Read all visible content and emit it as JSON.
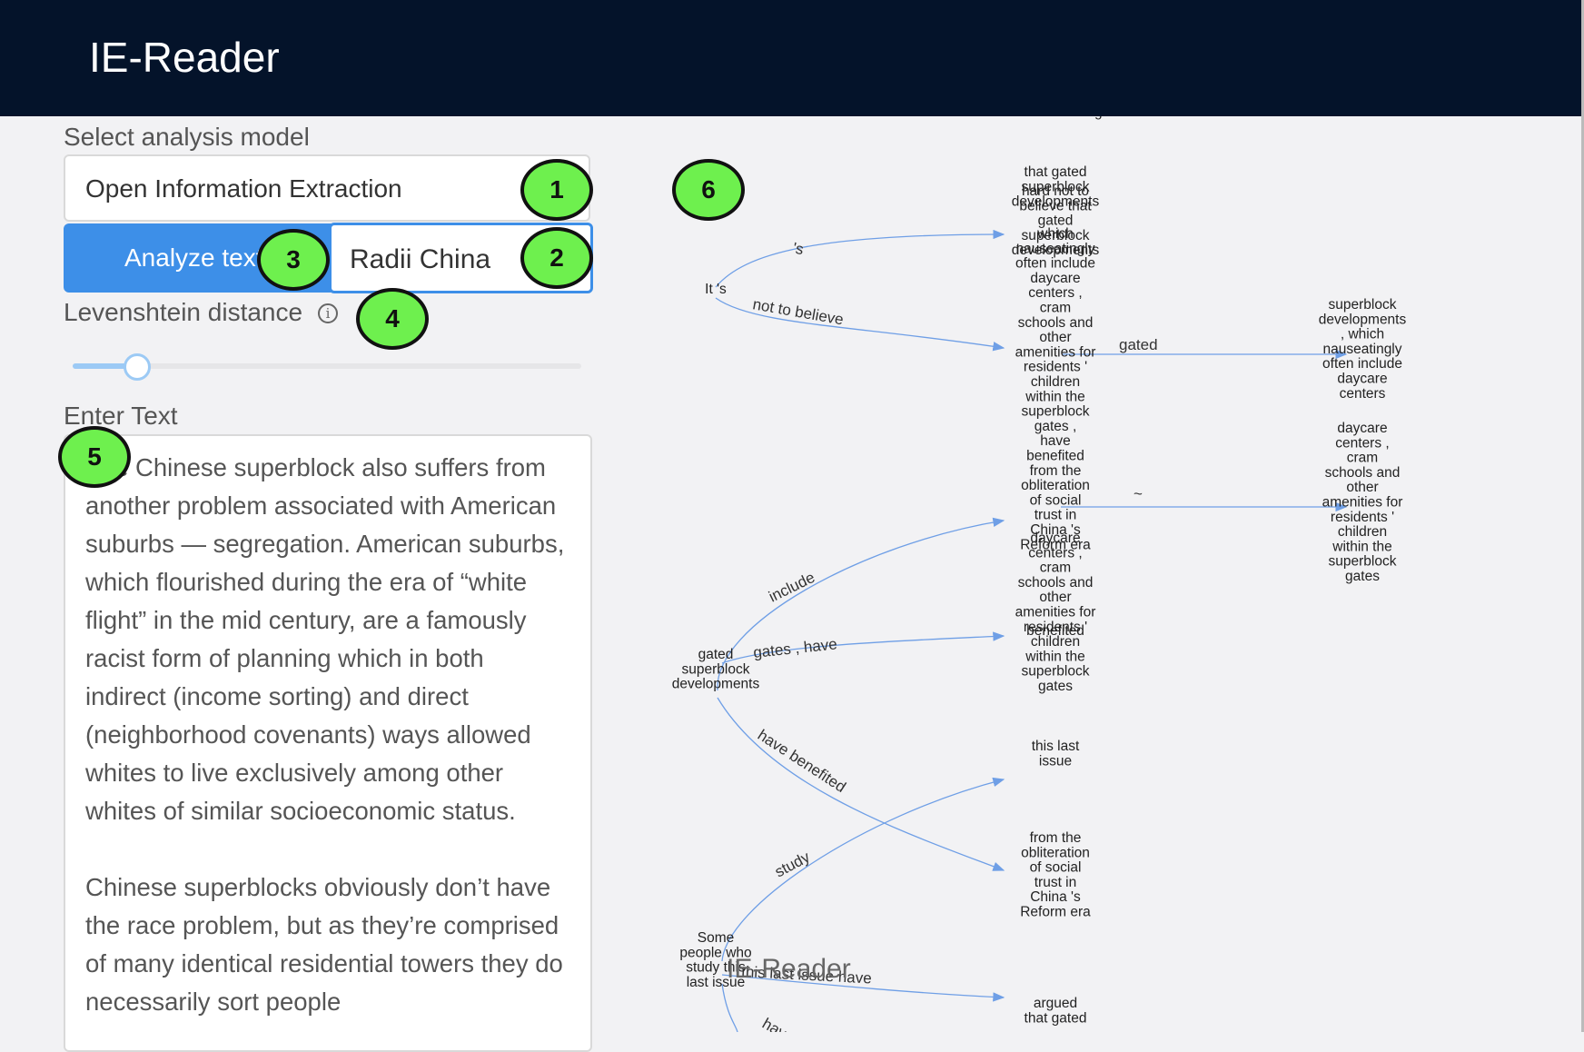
{
  "header": {
    "title": "IE-Reader"
  },
  "controls": {
    "model_label": "Select analysis model",
    "model_value": "Open Information Extraction",
    "analyze_label": "Analyze text",
    "entity_value": "Radii China",
    "levenshtein_label": "Levenshtein distance",
    "levenshtein_value": 0.1,
    "text_label": "Enter Text",
    "text_p1": "The Chinese superblock also suffers from another problem associated with American suburbs — segregation. American suburbs, which flourished during the era of “white flight” in the mid century, are a famously racist form of planning which in both indirect (income sorting) and direct (neighborhood covenants) ways allowed whites to live exclusively among other whites of similar socioeconomic status.",
    "text_p2": "Chinese superblocks obviously don’t have the race problem, but as they’re comprised of many identical residential towers they do necessarily sort people"
  },
  "badges": [
    "1",
    "2",
    "3",
    "4",
    "5",
    "6"
  ],
  "graph": {
    "nodes": [
      {
        "id": "top",
        "text": [
          "r o m e t h i n g"
        ]
      },
      {
        "id": "its",
        "text": [
          "It 's"
        ]
      },
      {
        "id": "a1",
        "text": [
          "that gated",
          "superblock",
          "developments"
        ]
      },
      {
        "id": "a2",
        "text": [
          "hard not to",
          "believe that",
          "gated",
          "superblock",
          "developments"
        ]
      },
      {
        "id": "a3",
        "text": [
          "which",
          "nauseatingly",
          "often include",
          "daycare",
          "centers ,",
          "cram",
          "schools and",
          "other",
          "amenities for",
          "residents '",
          "children",
          "within the",
          "superblock",
          "gates ,",
          "have",
          "benefited",
          "from the",
          "obliteration",
          "of social",
          "trust in",
          "China 's",
          "Reform era"
        ]
      },
      {
        "id": "sd",
        "text": [
          "superblock",
          "developments",
          ", which",
          "nauseatingly",
          "often include",
          "daycare",
          "centers"
        ]
      },
      {
        "id": "dc",
        "text": [
          "daycare",
          "centers ,",
          "cram",
          "schools and",
          "other",
          "amenities for",
          "residents '",
          "children",
          "within the",
          "superblock",
          "gates"
        ]
      },
      {
        "id": "dc2",
        "text": [
          "daycare",
          "centers ,",
          "cram",
          "schools and",
          "other",
          "amenities for",
          "residents '",
          "children",
          "within the",
          "superblock",
          "gates"
        ]
      },
      {
        "id": "gsd",
        "text": [
          "gated",
          "superblock",
          "developments"
        ]
      },
      {
        "id": "ben",
        "text": [
          "benefited"
        ]
      },
      {
        "id": "tli",
        "text": [
          "this last",
          "issue"
        ]
      },
      {
        "id": "fro",
        "text": [
          "from the",
          "obliteration",
          "of social",
          "trust in",
          "China 's",
          "Reform era"
        ]
      },
      {
        "id": "sp",
        "text": [
          "Some",
          "people who",
          "study this",
          "last issue"
        ]
      },
      {
        "id": "arg",
        "text": [
          "argued",
          "that gated"
        ]
      }
    ],
    "edges": [
      {
        "label": "'s"
      },
      {
        "label": "not to believe"
      },
      {
        "label": "gated"
      },
      {
        "label": "~"
      },
      {
        "label": "include"
      },
      {
        "label": "gates , have"
      },
      {
        "label": "have benefited"
      },
      {
        "label": "study"
      },
      {
        "label": "this last issue have"
      },
      {
        "label": "have"
      }
    ],
    "watermark": "IE-Reader"
  },
  "colors": {
    "topbar": "#04132a",
    "accent": "#3d8fe8",
    "badge": "#6ef04e",
    "edge": "#6f9fe6"
  }
}
